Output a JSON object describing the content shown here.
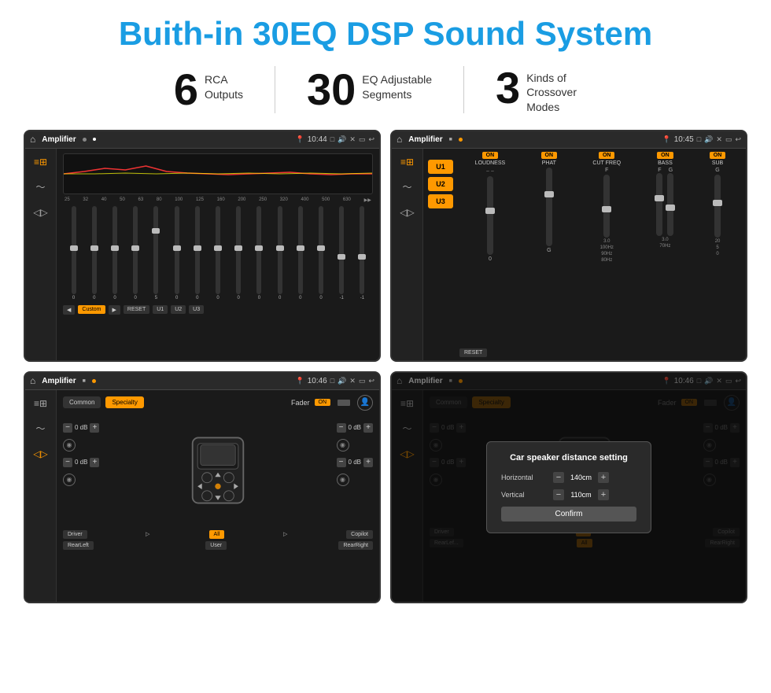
{
  "page": {
    "title": "Buith-in 30EQ DSP Sound System",
    "stats": [
      {
        "number": "6",
        "label": "RCA\nOutputs"
      },
      {
        "number": "30",
        "label": "EQ Adjustable\nSegments"
      },
      {
        "number": "3",
        "label": "Kinds of\nCrossover Modes"
      }
    ],
    "screens": [
      {
        "id": "screen1",
        "topbar": {
          "title": "Amplifier",
          "time": "10:44"
        },
        "type": "eq"
      },
      {
        "id": "screen2",
        "topbar": {
          "title": "Amplifier",
          "time": "10:45"
        },
        "type": "crossover"
      },
      {
        "id": "screen3",
        "topbar": {
          "title": "Amplifier",
          "time": "10:46"
        },
        "type": "fader"
      },
      {
        "id": "screen4",
        "topbar": {
          "title": "Amplifier",
          "time": "10:46"
        },
        "type": "fader-dialog"
      }
    ],
    "eq": {
      "freqs": [
        "25",
        "32",
        "40",
        "50",
        "63",
        "80",
        "100",
        "125",
        "160",
        "200",
        "250",
        "320",
        "400",
        "500",
        "630"
      ],
      "values": [
        "0",
        "0",
        "0",
        "0",
        "5",
        "0",
        "0",
        "0",
        "0",
        "0",
        "0",
        "0",
        "0",
        "-1",
        "0",
        "-1"
      ],
      "preset": "Custom",
      "buttons": [
        "RESET",
        "U1",
        "U2",
        "U3"
      ]
    },
    "crossover": {
      "u_buttons": [
        "U1",
        "U2",
        "U3"
      ],
      "controls": [
        {
          "label": "LOUDNESS",
          "on": true
        },
        {
          "label": "PHAT",
          "on": true
        },
        {
          "label": "CUT FREQ",
          "on": true
        },
        {
          "label": "BASS",
          "on": true
        },
        {
          "label": "SUB",
          "on": true
        }
      ],
      "reset_label": "RESET"
    },
    "fader": {
      "tabs": [
        "Common",
        "Specialty"
      ],
      "fader_label": "Fader",
      "on_badge": "ON",
      "channels": [
        {
          "label": "0 dB"
        },
        {
          "label": "0 dB"
        },
        {
          "label": "0 dB"
        },
        {
          "label": "0 dB"
        }
      ],
      "bottom_buttons": [
        "Driver",
        "All",
        "RearLeft",
        "User",
        "RearRight",
        "Copilot"
      ]
    },
    "dialog": {
      "title": "Car speaker distance setting",
      "rows": [
        {
          "label": "Horizontal",
          "value": "140cm"
        },
        {
          "label": "Vertical",
          "value": "110cm"
        }
      ],
      "confirm_label": "Confirm"
    }
  }
}
